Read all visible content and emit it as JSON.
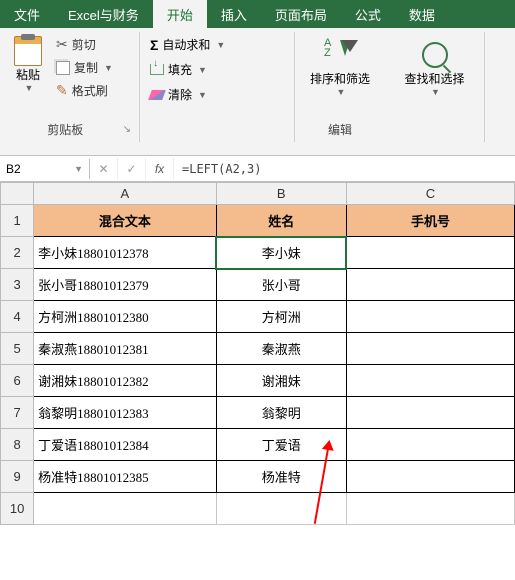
{
  "tabs": {
    "file": "文件",
    "excel_finance": "Excel与财务",
    "home": "开始",
    "insert": "插入",
    "layout": "页面布局",
    "formula": "公式",
    "data": "数据"
  },
  "ribbon": {
    "clipboard": {
      "paste": "粘贴",
      "cut": "剪切",
      "copy": "复制",
      "format_painter": "格式刷",
      "group_label": "剪贴板"
    },
    "editing": {
      "autosum": "自动求和",
      "fill": "填充",
      "clear": "清除",
      "sort_filter": "排序和筛选",
      "find_select": "查找和选择",
      "group_label": "编辑"
    }
  },
  "formula_bar": {
    "name_box": "B2",
    "cancel": "✕",
    "confirm": "✓",
    "fx": "fx",
    "formula": "=LEFT(A2,3)"
  },
  "sheet": {
    "cols": [
      "A",
      "B",
      "C"
    ],
    "headers": {
      "a": "混合文本",
      "b": "姓名",
      "c": "手机号"
    },
    "rows": [
      {
        "n": "1"
      },
      {
        "n": "2",
        "a": "李小妹18801012378",
        "b": "李小妹"
      },
      {
        "n": "3",
        "a": "张小哥18801012379",
        "b": "张小哥"
      },
      {
        "n": "4",
        "a": "方柯洲18801012380",
        "b": "方柯洲"
      },
      {
        "n": "5",
        "a": "秦淑燕18801012381",
        "b": "秦淑燕"
      },
      {
        "n": "6",
        "a": "谢湘妹18801012382",
        "b": "谢湘妹"
      },
      {
        "n": "7",
        "a": "翁黎明18801012383",
        "b": "翁黎明"
      },
      {
        "n": "8",
        "a": "丁爱语18801012384",
        "b": "丁爱语"
      },
      {
        "n": "9",
        "a": "杨准特18801012385",
        "b": "杨准特"
      },
      {
        "n": "10"
      }
    ]
  }
}
